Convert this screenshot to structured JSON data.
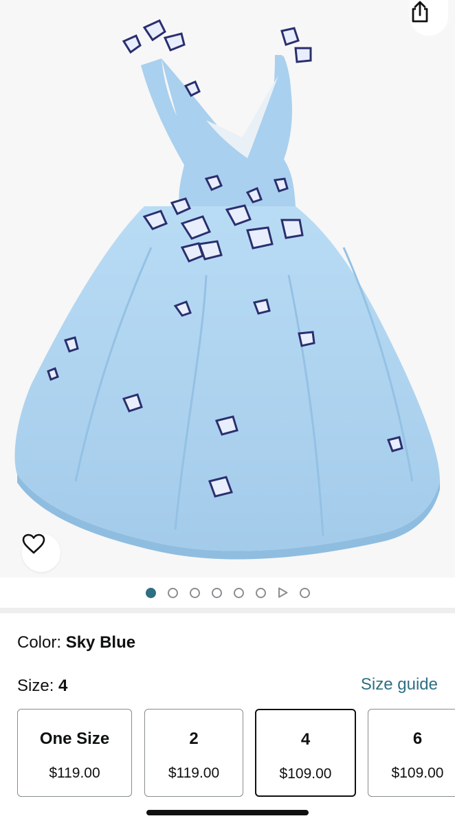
{
  "product": {
    "image_name": "sky-blue-butterfly-dress-photo"
  },
  "carousel": {
    "dots": [
      "image",
      "image",
      "image",
      "image",
      "image",
      "image",
      "video",
      "image"
    ],
    "active_index": 0
  },
  "color": {
    "label": "Color:",
    "value": "Sky Blue"
  },
  "size": {
    "label": "Size:",
    "value": "4",
    "guide_label": "Size guide",
    "options": [
      {
        "size": "One Size",
        "price": "$119.00",
        "selected": false
      },
      {
        "size": "2",
        "price": "$119.00",
        "selected": false
      },
      {
        "size": "4",
        "price": "$109.00",
        "selected": true
      },
      {
        "size": "6",
        "price": "$109.00",
        "selected": false
      }
    ]
  },
  "colors": {
    "accent": "#2f6f83",
    "dress": "#a9d0ee",
    "text": "#0f1111"
  }
}
